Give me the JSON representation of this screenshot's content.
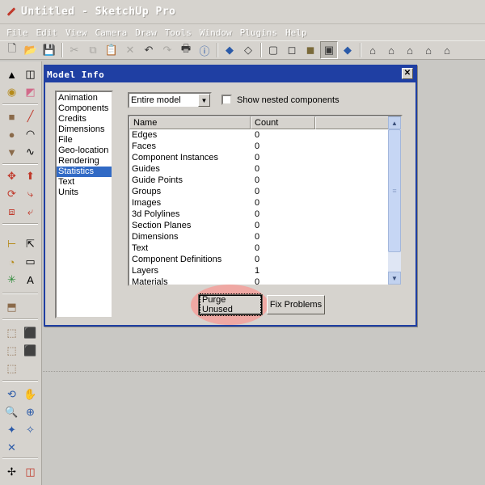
{
  "window": {
    "title": "Untitled - SketchUp Pro"
  },
  "menu": [
    "File",
    "Edit",
    "View",
    "Camera",
    "Draw",
    "Tools",
    "Window",
    "Plugins",
    "Help"
  ],
  "dialog": {
    "title": "Model Info",
    "close_glyph": "✕",
    "categories": [
      "Animation",
      "Components",
      "Credits",
      "Dimensions",
      "File",
      "Geo-location",
      "Rendering",
      "Statistics",
      "Text",
      "Units"
    ],
    "selected_category": "Statistics",
    "scope_select": {
      "value": "Entire model"
    },
    "nested_checkbox": {
      "label": "Show nested components",
      "checked": false
    },
    "table": {
      "columns": [
        "Name",
        "Count"
      ],
      "rows": [
        {
          "name": "Edges",
          "count": "0"
        },
        {
          "name": "Faces",
          "count": "0"
        },
        {
          "name": "Component Instances",
          "count": "0"
        },
        {
          "name": "Guides",
          "count": "0"
        },
        {
          "name": "Guide Points",
          "count": "0"
        },
        {
          "name": "Groups",
          "count": "0"
        },
        {
          "name": "Images",
          "count": "0"
        },
        {
          "name": "3d Polylines",
          "count": "0"
        },
        {
          "name": "Section Planes",
          "count": "0"
        },
        {
          "name": "Dimensions",
          "count": "0"
        },
        {
          "name": "Text",
          "count": "0"
        },
        {
          "name": "Component Definitions",
          "count": "0"
        },
        {
          "name": "Layers",
          "count": "1"
        },
        {
          "name": "Materials",
          "count": "0"
        }
      ]
    },
    "buttons": {
      "purge": "Purge Unused",
      "fix": "Fix Problems"
    }
  },
  "toolbar_top": [
    {
      "icon": "new-icon",
      "glyph": "🗋"
    },
    {
      "icon": "open-icon",
      "glyph": "📂"
    },
    {
      "icon": "save-icon",
      "glyph": "💾"
    },
    {
      "icon": "cut-icon",
      "glyph": "✂"
    },
    {
      "icon": "copy-icon",
      "glyph": "⧉"
    },
    {
      "icon": "paste-icon",
      "glyph": "📋"
    },
    {
      "icon": "erase-icon",
      "glyph": "✕"
    },
    {
      "icon": "undo-icon",
      "glyph": "↶"
    },
    {
      "icon": "redo-icon",
      "glyph": "↷"
    },
    {
      "icon": "print-icon",
      "glyph": "🖶"
    },
    {
      "icon": "model-info-icon",
      "glyph": "ⓘ"
    },
    {
      "icon": "xray-icon",
      "glyph": "◆"
    },
    {
      "icon": "back-edges-icon",
      "glyph": "◇"
    },
    {
      "icon": "wireframe-icon",
      "glyph": "▢"
    },
    {
      "icon": "hidden-line-icon",
      "glyph": "◻"
    },
    {
      "icon": "shaded-icon",
      "glyph": "◼"
    },
    {
      "icon": "shaded-textures-icon",
      "glyph": "▣"
    },
    {
      "icon": "monochrome-icon",
      "glyph": "◆"
    },
    {
      "icon": "iso-view-icon",
      "glyph": "⌂"
    },
    {
      "icon": "top-view-icon",
      "glyph": "⌂"
    },
    {
      "icon": "front-view-icon",
      "glyph": "⌂"
    },
    {
      "icon": "right-view-icon",
      "glyph": "⌂"
    },
    {
      "icon": "back-view-icon",
      "glyph": "⌂"
    },
    {
      "icon": "left-view-icon",
      "glyph": "⌂"
    }
  ],
  "toolbar_left": [
    [
      "select-icon",
      "▲",
      "eraser-icon",
      "◫"
    ],
    [
      "paint-bucket-icon",
      "◉",
      "eraser-pink-icon",
      "◩"
    ],
    [
      "rectangle-icon",
      "■",
      "line-icon",
      "╱"
    ],
    [
      "circle-icon",
      "●",
      "arc-icon",
      "◠"
    ],
    [
      "polygon-icon",
      "▼",
      "freehand-icon",
      "∿"
    ],
    [
      "move-icon",
      "✥",
      "push-pull-icon",
      "⬆"
    ],
    [
      "rotate-icon",
      "⟳",
      "follow-me-icon",
      "⤷"
    ],
    [
      "scale-icon",
      "⧈",
      "offset-icon",
      "⤶"
    ],
    [
      "tape-measure-icon",
      "⊢",
      "dimension-icon",
      "⇱"
    ],
    [
      "protractor-icon",
      "◔",
      "text-icon",
      "▭"
    ],
    [
      "axes-icon",
      "✳",
      "3d-text-icon",
      "A"
    ],
    [
      "section-plane-icon",
      "⬒",
      "",
      ""
    ],
    [
      "component-icon",
      "⬚",
      "group-icon",
      "⬛"
    ],
    [
      "component2-icon",
      "⬚",
      "group2-icon",
      "⬛"
    ],
    [
      "component3-icon",
      "⬚",
      "",
      ""
    ],
    [
      "orbit-icon",
      "⟲",
      "pan-icon",
      "✋"
    ],
    [
      "zoom-icon",
      "🔍",
      "zoom-window-icon",
      "⊕"
    ],
    [
      "zoom-extents-icon",
      "✦",
      "previous-icon",
      "✧"
    ],
    [
      "position-camera-icon",
      "✕",
      "",
      ""
    ],
    [
      "walk-icon",
      "✢",
      "look-around-icon",
      "◫"
    ]
  ]
}
